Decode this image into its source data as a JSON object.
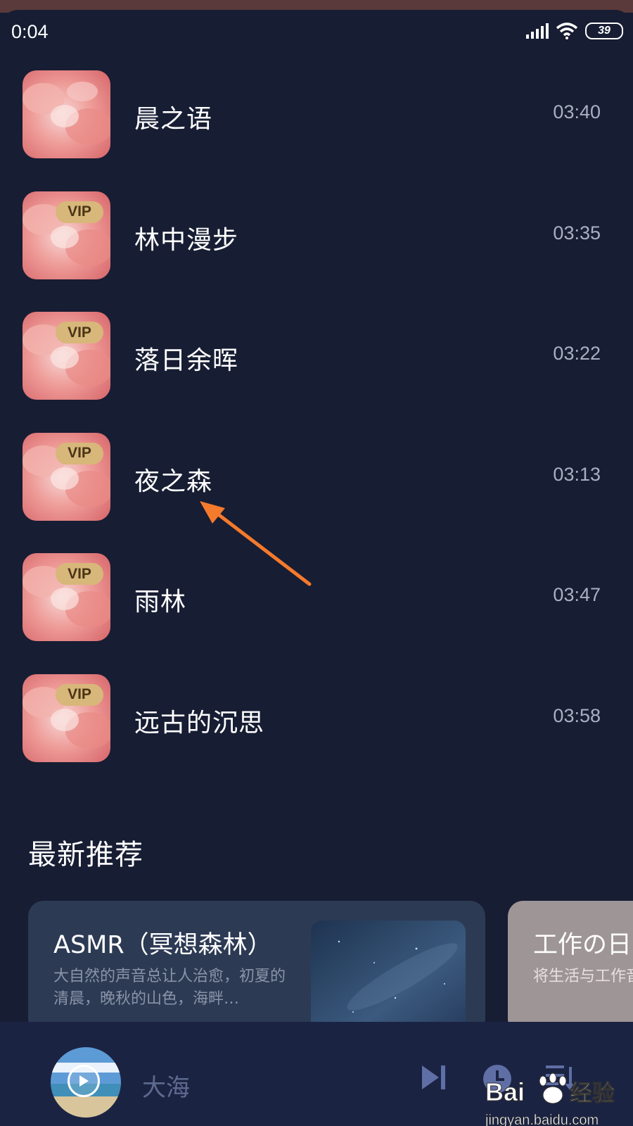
{
  "status_bar": {
    "time": "0:04",
    "battery": "39"
  },
  "tracks": [
    {
      "title": "晨之语",
      "duration": "03:40",
      "vip": false
    },
    {
      "title": "林中漫步",
      "duration": "03:35",
      "vip": true
    },
    {
      "title": "落日余晖",
      "duration": "03:22",
      "vip": true
    },
    {
      "title": "夜之森",
      "duration": "03:13",
      "vip": true
    },
    {
      "title": "雨林",
      "duration": "03:47",
      "vip": true
    },
    {
      "title": "远古的沉思",
      "duration": "03:58",
      "vip": true
    }
  ],
  "vip_label": "VIP",
  "section": {
    "title": "最新推荐"
  },
  "recommendations": [
    {
      "title": "ASMR（冥想森林）",
      "desc": "大自然的声音总让人治愈，初夏的清晨，晚秋的山色，海畔…"
    },
    {
      "title": "工作の日",
      "desc": "将生活与工作音的角度去看"
    }
  ],
  "player": {
    "now_playing": "大海"
  },
  "watermark": {
    "brand": "Bai",
    "brand2": "经验",
    "url": "jingyan.baidu.com"
  },
  "colors": {
    "background": "#171d33",
    "vip_badge": "#d8b77a",
    "arrow": "#f47a2c"
  }
}
